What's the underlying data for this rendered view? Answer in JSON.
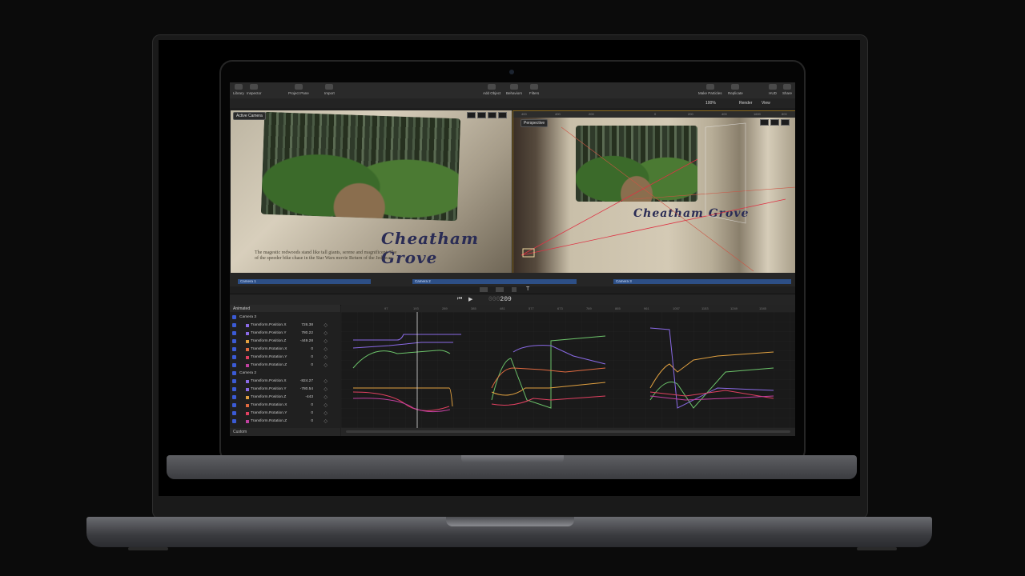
{
  "toolbar": {
    "library": "Library",
    "inspector": "Inspector",
    "project_pane": "Project Pane",
    "import": "Import",
    "add_object": "Add Object",
    "behaviors": "Behaviors",
    "filters": "Filters",
    "make_particles": "Make Particles",
    "replicate": "Replicate",
    "hud": "HUD",
    "share": "Share"
  },
  "viewer_bar": {
    "zoom": "100%",
    "render": "Render",
    "view": "View"
  },
  "canvas": {
    "left_label": "Active Camera",
    "right_label": "Perspective",
    "title_text": "Cheatham Grove",
    "body_line_1": "The magestic redwoods stand like tall giants, serene and magnificent. The",
    "body_line_2": "of the speeder bike chase in the Star Wars movie Return of the Jedi was",
    "right_ruler": [
      "400",
      "400",
      "200",
      "0",
      "200",
      "400",
      "1600",
      "800"
    ]
  },
  "cameras": [
    "Camera 1",
    "Camera 2",
    "Camera 3"
  ],
  "timecode": {
    "prefix": "000",
    "frame": "209"
  },
  "params": {
    "filter": "Animated",
    "footer": "Custom",
    "groups": [
      {
        "name": "Camera 3",
        "rows": [
          {
            "name": "Transform.Position.X",
            "value": "726.38",
            "color": "#8a6ae6"
          },
          {
            "name": "Transform.Position.Y",
            "value": "780.22",
            "color": "#8a6ae6"
          },
          {
            "name": "Transform.Position.Z",
            "value": "-449.28",
            "color": "#e0a040"
          },
          {
            "name": "Transform.Rotation.X",
            "value": "0",
            "color": "#e06a40"
          },
          {
            "name": "Transform.Rotation.Y",
            "value": "0",
            "color": "#e04060"
          },
          {
            "name": "Transform.Rotation.Z",
            "value": "0",
            "color": "#c040a0"
          }
        ]
      },
      {
        "name": "Camera 2",
        "rows": [
          {
            "name": "Transform.Position.X",
            "value": "-824.27",
            "color": "#8a6ae6"
          },
          {
            "name": "Transform.Position.Y",
            "value": "-780.54",
            "color": "#8a6ae6"
          },
          {
            "name": "Transform.Position.Z",
            "value": "-443",
            "color": "#e0a040"
          },
          {
            "name": "Transform.Rotation.X",
            "value": "0",
            "color": "#e06a40"
          },
          {
            "name": "Transform.Rotation.Y",
            "value": "0",
            "color": "#e04060"
          },
          {
            "name": "Transform.Rotation.Z",
            "value": "0",
            "color": "#c040a0"
          }
        ]
      }
    ]
  },
  "graph_ruler": [
    "97",
    "193",
    "289",
    "385",
    "481",
    "577",
    "673",
    "769",
    "865",
    "961",
    "1057",
    "1153",
    "1249",
    "1345"
  ]
}
